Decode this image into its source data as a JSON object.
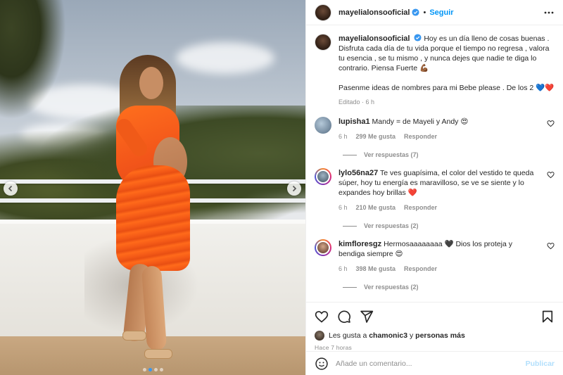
{
  "header": {
    "username": "mayelialonsooficial",
    "separator": "•",
    "follow_label": "Seguir"
  },
  "caption": {
    "username": "mayelialonsooficial",
    "text_1": "Hoy es un día lleno de cosas buenas . Disfruta cada día de tu vida porque el tiempo no regresa , valora tu esencia , se tu mismo , y nunca dejes que nadie te diga lo contrario. Piensa Fuerte 💪🏾",
    "text_2": "Pasenme ideas de nombres para mi Bebe please . De los 2 💙❤️",
    "edited": "Editado · 6 h"
  },
  "comments": [
    {
      "username": "lupisha1",
      "text": "Mandy = de Mayeli y Andy 😍",
      "time": "6 h",
      "likes": "299 Me gusta",
      "reply_label": "Responder",
      "view_replies": "Ver respuestas (7)"
    },
    {
      "username": "lylo56na27",
      "text": "Te ves guapísima, el color del vestido te queda súper, hoy tu energía es maravilloso, se ve se siente y lo expandes hoy brillas ❤️",
      "time": "6 h",
      "likes": "210 Me gusta",
      "reply_label": "Responder",
      "view_replies": "Ver respuestas (2)"
    },
    {
      "username": "kimfloresgz",
      "text": "Hermosaaaaaaaa 🖤 Dios los proteja y bendiga siempre 😍",
      "time": "6 h",
      "likes": "398 Me gusta",
      "reply_label": "Responder",
      "view_replies": "Ver respuestas (2)"
    }
  ],
  "likes": {
    "prefix": "Les gusta a",
    "user": "chamonic3",
    "connector": "y",
    "others": "personas más"
  },
  "timestamp": "Hace 7 horas",
  "add_comment": {
    "placeholder": "Añade un comentario...",
    "publish_label": "Publicar"
  },
  "carousel": {
    "total_slides": 4,
    "active_slide": 2
  },
  "colors": {
    "accent": "#0095f6",
    "verified": "#3897f0",
    "publish_disabled": "#b2dffc",
    "dress": "#f45a17"
  }
}
